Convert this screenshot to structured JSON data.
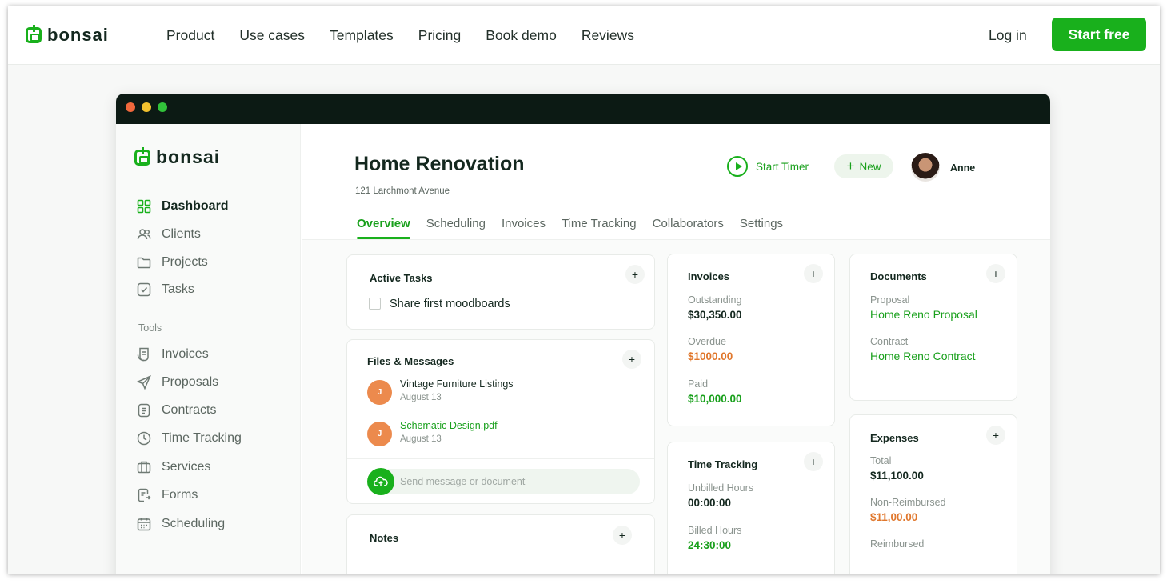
{
  "brand": {
    "name": "bonsai",
    "accent": "#19b01c"
  },
  "nav": {
    "links": [
      "Product",
      "Use cases",
      "Templates",
      "Pricing",
      "Book demo",
      "Reviews"
    ],
    "login": "Log in",
    "cta": "Start free"
  },
  "sidebar": {
    "items": [
      {
        "label": "Dashboard",
        "icon": "grid-icon"
      },
      {
        "label": "Clients",
        "icon": "users-icon"
      },
      {
        "label": "Projects",
        "icon": "folder-icon"
      },
      {
        "label": "Tasks",
        "icon": "checkbox-icon"
      }
    ],
    "tools_heading": "Tools",
    "tools": [
      {
        "label": "Invoices",
        "icon": "invoice-icon"
      },
      {
        "label": "Proposals",
        "icon": "send-icon"
      },
      {
        "label": "Contracts",
        "icon": "document-icon"
      },
      {
        "label": "Time Tracking",
        "icon": "clock-icon"
      },
      {
        "label": "Services",
        "icon": "briefcase-icon"
      },
      {
        "label": "Forms",
        "icon": "form-icon"
      },
      {
        "label": "Scheduling",
        "icon": "calendar-icon"
      }
    ]
  },
  "project": {
    "title": "Home Renovation",
    "address": "121 Larchmont Avenue",
    "start_timer": "Start Timer",
    "new_label": "New",
    "user": "Anne"
  },
  "tabs": [
    "Overview",
    "Scheduling",
    "Invoices",
    "Time Tracking",
    "Collaborators",
    "Settings"
  ],
  "active_tasks": {
    "title": "Active Tasks",
    "tasks": [
      "Share first moodboards"
    ]
  },
  "files": {
    "title": "Files & Messages",
    "items": [
      {
        "initial": "J",
        "name": "Vintage Furniture Listings",
        "date": "August 13"
      },
      {
        "initial": "J",
        "name": "Schematic Design.pdf",
        "date": "August 13"
      }
    ],
    "placeholder": "Send message or document"
  },
  "notes": {
    "title": "Notes"
  },
  "invoices": {
    "title": "Invoices",
    "outstanding_label": "Outstanding",
    "outstanding": "$30,350.00",
    "overdue_label": "Overdue",
    "overdue": "$1000.00",
    "paid_label": "Paid",
    "paid": "$10,000.00"
  },
  "time_tracking": {
    "title": "Time Tracking",
    "unbilled_label": "Unbilled Hours",
    "unbilled": "00:00:00",
    "billed_label": "Billed Hours",
    "billed": "24:30:00"
  },
  "documents": {
    "title": "Documents",
    "proposal_label": "Proposal",
    "proposal": "Home Reno Proposal",
    "contract_label": "Contract",
    "contract": "Home Reno Contract"
  },
  "expenses": {
    "title": "Expenses",
    "total_label": "Total",
    "total": "$11,100.00",
    "nonreimb_label": "Non-Reimbursed",
    "nonreimb": "$11,00.00",
    "reimb_label": "Reimbursed"
  }
}
